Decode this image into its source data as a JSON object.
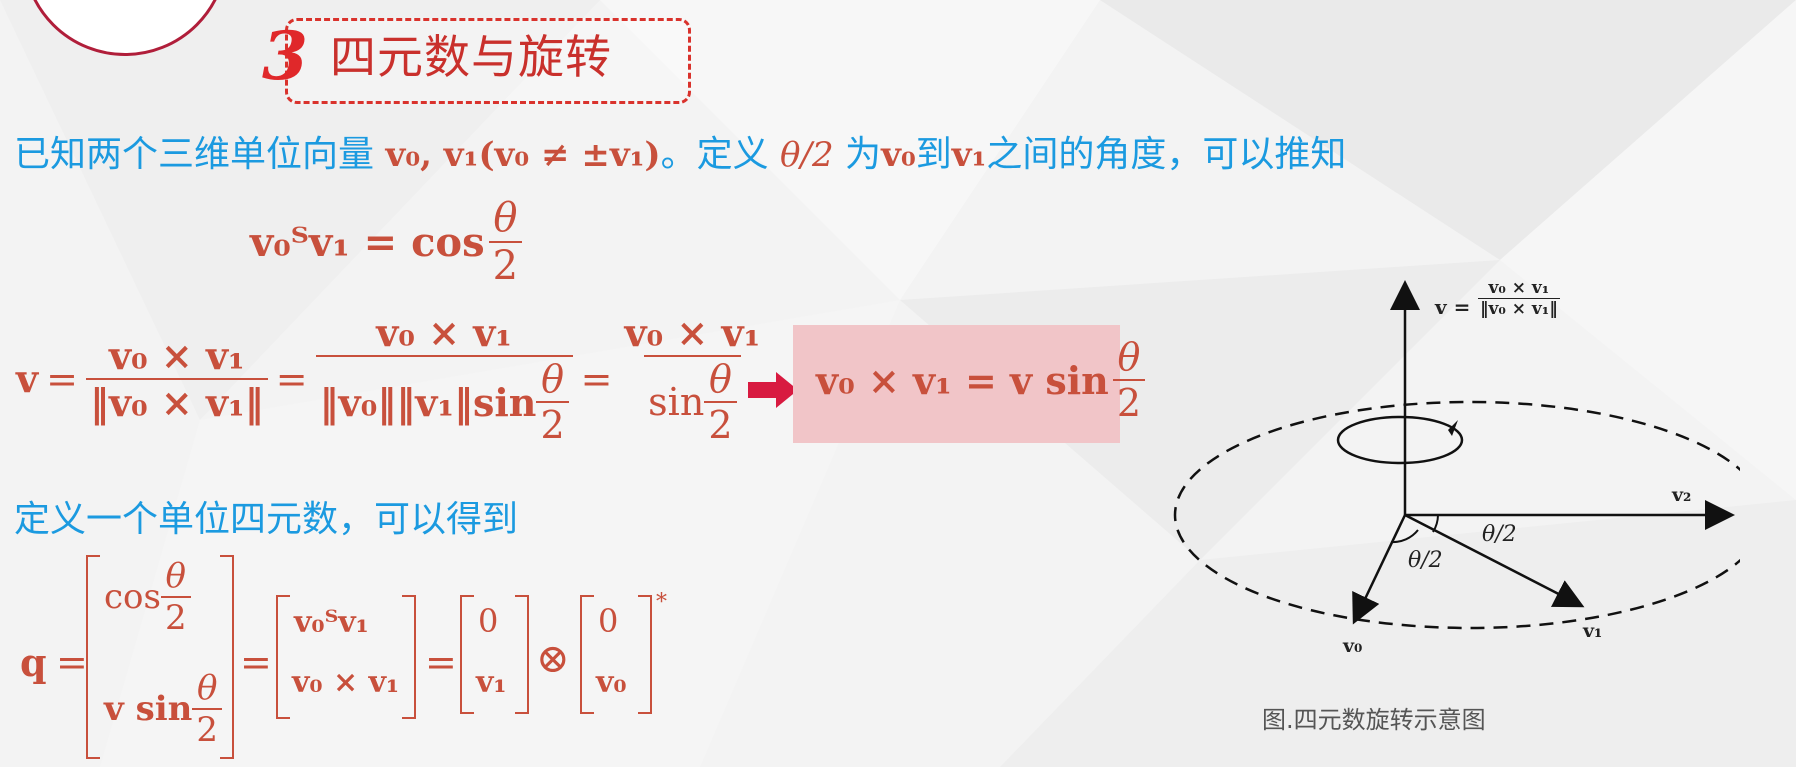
{
  "title": {
    "number": "3",
    "text": "四元数与旋转"
  },
  "line1": {
    "prefix": "已知两个三维单位向量",
    "math": "v₀, v₁(v₀ ≠ ±v₁)",
    "mid": "。定义",
    "theta": "θ/2",
    "mid2": "为",
    "v0": "v₀",
    "to": "到",
    "v1": "v₁",
    "suffix": "之间的角度，可以推知"
  },
  "line3": {
    "text": "定义一个单位四元数，可以得到"
  },
  "eq1": {
    "lhs": "v₀ᵀv₁ = cos",
    "num": "θ",
    "den": "2"
  },
  "eq2": {
    "v": "v",
    "eq": "=",
    "f1_num": "v₀ × v₁",
    "f1_den": "‖v₀ × v₁‖",
    "f2_num": "v₀ × v₁",
    "f2_den": "‖v₀‖‖v₁‖sin",
    "f3_num": "v₀ × v₁",
    "f3_den": "sin",
    "theta": "θ",
    "two": "2"
  },
  "boxed": {
    "lhs": "v₀ × v₁ = v sin",
    "num": "θ",
    "den": "2"
  },
  "eq3": {
    "q": "q",
    "cos": "cos",
    "vsin": "v sin",
    "vt": "v₀ᵀv₁",
    "vx": "v₀ × v₁",
    "zero": "0",
    "v1": "v₁",
    "v0": "v₀",
    "otimes": "⊗",
    "star": "*"
  },
  "diagram": {
    "top_label": "v =",
    "top_num": "v₀ × v₁",
    "top_den": "‖v₀ × v₁‖",
    "v2": "v₂",
    "v1": "v₁",
    "v0": "v₀",
    "half1": "θ/2",
    "half2": "θ/2"
  },
  "caption": "图.四元数旋转示意图",
  "colors": {
    "blue": "#1b9ae0",
    "red": "#c8503c",
    "title": "#c9302c",
    "arrow": "#d81a40"
  }
}
